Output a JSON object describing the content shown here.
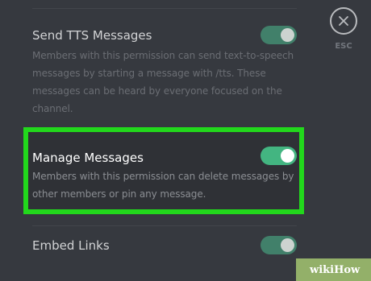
{
  "permissions": [
    {
      "title": "Send TTS Messages",
      "description": "Members with this permission can send text-to-speech messages by starting a message with /tts. These messages can be heard by everyone focused on the channel.",
      "enabled": true
    },
    {
      "title": "Manage Messages",
      "description": "Members with this permission can delete messages by other members or pin any message.",
      "enabled": true,
      "highlighted": true
    },
    {
      "title": "Embed Links",
      "enabled": true
    }
  ],
  "close": {
    "icon": "close-icon",
    "label": "ESC"
  },
  "watermark": "wikiHow",
  "colors": {
    "background": "#36393f",
    "toggle_on": "#43b581",
    "highlight": "#22d81c"
  }
}
